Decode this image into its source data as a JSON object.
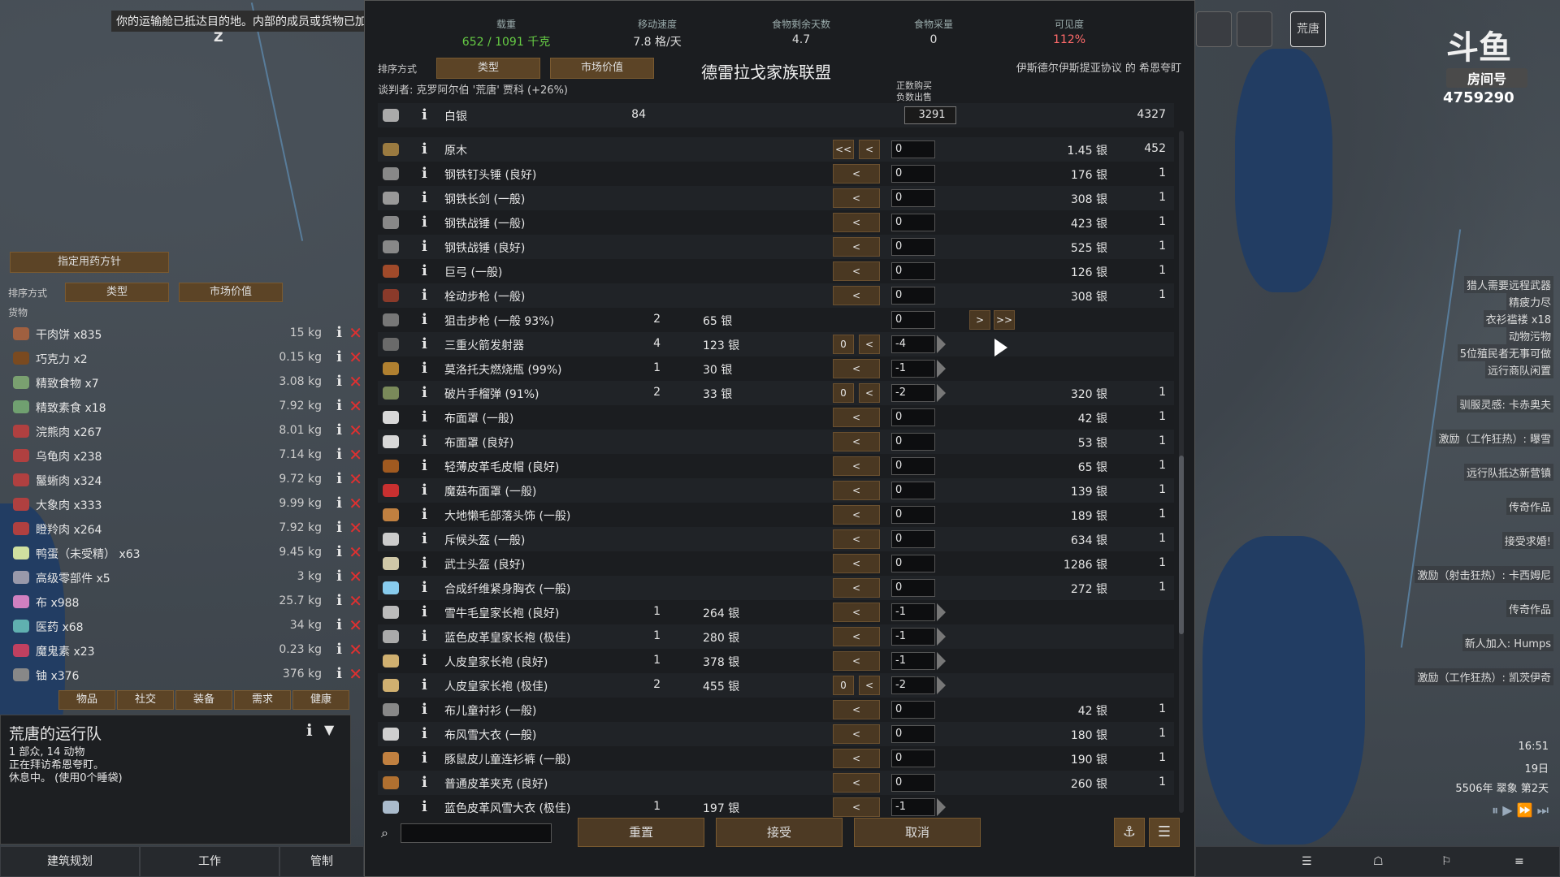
{
  "notification": "你的运输舱已抵达目的地。内部的成员或货物已加入荒唐的运行队。",
  "corner_letter": "Z",
  "stats": [
    {
      "label": "载重",
      "value": "652 / 1091 千克",
      "color": "#66cc44"
    },
    {
      "label": "移动速度",
      "value": "7.8 格/天",
      "color": "#dddddd"
    },
    {
      "label": "食物剩余天数",
      "value": "4.7",
      "color": "#dddddd"
    },
    {
      "label": "食物采量",
      "value": "0",
      "color": "#dddddd"
    },
    {
      "label": "可见度",
      "value": "112%",
      "color": "#ff6a6a"
    }
  ],
  "trade": {
    "sort_label": "排序方式",
    "sort_type": "类型",
    "sort_market": "市场价值",
    "faction": "德雷拉戈家族联盟",
    "settlement": "伊斯德尔伊斯提亚协议 的 希恩夸盯",
    "negotiator": "谈判者: 克罗阿尔伯 '荒唐' 贾科 (+26%)",
    "col_hint_1": "正数购买",
    "col_hint_2": "负数出售",
    "silver": {
      "name": "白银",
      "colony": "84",
      "amount": "3291",
      "trader": "4327"
    },
    "rows": [
      {
        "name": "原木",
        "cq": "",
        "cp": "",
        "left": "<<  <",
        "val": "0",
        "arrow": false,
        "tp": "1.45 银",
        "tq": "452",
        "icon": "#9a7a40"
      },
      {
        "name": "钢铁钉头锤 (良好)",
        "cq": "",
        "cp": "",
        "left": "<",
        "val": "0",
        "arrow": false,
        "tp": "176 银",
        "tq": "1",
        "icon": "#888888"
      },
      {
        "name": "钢铁长剑 (一般)",
        "cq": "",
        "cp": "",
        "left": "<",
        "val": "0",
        "arrow": false,
        "tp": "308 银",
        "tq": "1",
        "icon": "#999999"
      },
      {
        "name": "钢铁战锤 (一般)",
        "cq": "",
        "cp": "",
        "left": "<",
        "val": "0",
        "arrow": false,
        "tp": "423 银",
        "tq": "1",
        "icon": "#888888"
      },
      {
        "name": "钢铁战锤 (良好)",
        "cq": "",
        "cp": "",
        "left": "<",
        "val": "0",
        "arrow": false,
        "tp": "525 银",
        "tq": "1",
        "icon": "#888888"
      },
      {
        "name": "巨弓 (一般)",
        "cq": "",
        "cp": "",
        "left": "<",
        "val": "0",
        "arrow": false,
        "tp": "126 银",
        "tq": "1",
        "icon": "#a04a2a"
      },
      {
        "name": "栓动步枪 (一般)",
        "cq": "",
        "cp": "",
        "left": "<",
        "val": "0",
        "arrow": false,
        "tp": "308 银",
        "tq": "1",
        "icon": "#8a3a2a"
      },
      {
        "name": "狙击步枪 (一般 93%)",
        "cq": "2",
        "cp": "65 银",
        "left": "",
        "val": "0",
        "arrow": false,
        "tp": "",
        "tq": "",
        "icon": "#777777",
        "right": "> >>"
      },
      {
        "name": "三重火箭发射器",
        "cq": "4",
        "cp": "123 银",
        "left": "0 <",
        "val": "-4",
        "arrow": true,
        "tp": "",
        "tq": "",
        "icon": "#6a6a6a"
      },
      {
        "name": "莫洛托夫燃烧瓶 (99%)",
        "cq": "1",
        "cp": "30 银",
        "left": "<",
        "val": "-1",
        "arrow": true,
        "tp": "",
        "tq": "",
        "icon": "#b08030"
      },
      {
        "name": "破片手榴弹 (91%)",
        "cq": "2",
        "cp": "33 银",
        "left": "0 <",
        "val": "-2",
        "arrow": true,
        "tp": "320 银",
        "tq": "1",
        "icon": "#7a8a5a"
      },
      {
        "name": "布面罩 (一般)",
        "cq": "",
        "cp": "",
        "left": "<",
        "val": "0",
        "arrow": false,
        "tp": "42 银",
        "tq": "1",
        "icon": "#d8d8d8"
      },
      {
        "name": "布面罩 (良好)",
        "cq": "",
        "cp": "",
        "left": "<",
        "val": "0",
        "arrow": false,
        "tp": "53 银",
        "tq": "1",
        "icon": "#d8d8d8"
      },
      {
        "name": "轻薄皮革毛皮帽 (良好)",
        "cq": "",
        "cp": "",
        "left": "<",
        "val": "0",
        "arrow": false,
        "tp": "65 银",
        "tq": "1",
        "icon": "#a05a20"
      },
      {
        "name": "魔菇布面罩 (一般)",
        "cq": "",
        "cp": "",
        "left": "<",
        "val": "0",
        "arrow": false,
        "tp": "139 银",
        "tq": "1",
        "icon": "#c83030"
      },
      {
        "name": "大地懒毛部落头饰 (一般)",
        "cq": "",
        "cp": "",
        "left": "<",
        "val": "0",
        "arrow": false,
        "tp": "189 银",
        "tq": "1",
        "icon": "#c08040"
      },
      {
        "name": "斥候头盔 (一般)",
        "cq": "",
        "cp": "",
        "left": "<",
        "val": "0",
        "arrow": false,
        "tp": "634 银",
        "tq": "1",
        "icon": "#cccccc"
      },
      {
        "name": "武士头盔 (良好)",
        "cq": "",
        "cp": "",
        "left": "<",
        "val": "0",
        "arrow": false,
        "tp": "1286 银",
        "tq": "1",
        "icon": "#d0c8a8"
      },
      {
        "name": "合成纤维紧身胸衣 (一般)",
        "cq": "",
        "cp": "",
        "left": "<",
        "val": "0",
        "arrow": false,
        "tp": "272 银",
        "tq": "1",
        "icon": "#88ccee"
      },
      {
        "name": "雪牛毛皇家长袍 (良好)",
        "cq": "1",
        "cp": "264 银",
        "left": "<",
        "val": "-1",
        "arrow": true,
        "tp": "",
        "tq": "",
        "icon": "#bbbbbb"
      },
      {
        "name": "蓝色皮革皇家长袍 (极佳)",
        "cq": "1",
        "cp": "280 银",
        "left": "<",
        "val": "-1",
        "arrow": true,
        "tp": "",
        "tq": "",
        "icon": "#aaaaaa"
      },
      {
        "name": "人皮皇家长袍 (良好)",
        "cq": "1",
        "cp": "378 银",
        "left": "<",
        "val": "-1",
        "arrow": true,
        "tp": "",
        "tq": "",
        "icon": "#d0b070"
      },
      {
        "name": "人皮皇家长袍 (极佳)",
        "cq": "2",
        "cp": "455 银",
        "left": "0 <",
        "val": "-2",
        "arrow": true,
        "tp": "",
        "tq": "",
        "icon": "#d0b070"
      },
      {
        "name": "布儿童衬衫 (一般)",
        "cq": "",
        "cp": "",
        "left": "<",
        "val": "0",
        "arrow": false,
        "tp": "42 银",
        "tq": "1",
        "icon": "#888888"
      },
      {
        "name": "布风雪大衣 (一般)",
        "cq": "",
        "cp": "",
        "left": "<",
        "val": "0",
        "arrow": false,
        "tp": "180 银",
        "tq": "1",
        "icon": "#cfcfcf"
      },
      {
        "name": "豚鼠皮儿童连衫裤 (一般)",
        "cq": "",
        "cp": "",
        "left": "<",
        "val": "0",
        "arrow": false,
        "tp": "190 银",
        "tq": "1",
        "icon": "#c08040"
      },
      {
        "name": "普通皮革夹克 (良好)",
        "cq": "",
        "cp": "",
        "left": "<",
        "val": "0",
        "arrow": false,
        "tp": "260 银",
        "tq": "1",
        "icon": "#b07030"
      },
      {
        "name": "蓝色皮革风雪大衣 (极佳)",
        "cq": "1",
        "cp": "197 银",
        "left": "<",
        "val": "-1",
        "arrow": true,
        "tp": "",
        "tq": "",
        "icon": "#aabbcc"
      }
    ],
    "reset": "重置",
    "accept": "接受",
    "cancel": "取消"
  },
  "left": {
    "policy_button": "指定用药方针",
    "sort_label": "排序方式",
    "sort_type": "类型",
    "sort_market": "市场价值",
    "section": "货物",
    "items": [
      {
        "name": "干肉饼 x835",
        "wt": "15 kg",
        "icon": "#a06040"
      },
      {
        "name": "巧克力 x2",
        "wt": "0.15 kg",
        "icon": "#7a4a20"
      },
      {
        "name": "精致食物 x7",
        "wt": "3.08 kg",
        "icon": "#7aa070"
      },
      {
        "name": "精致素食 x18",
        "wt": "7.92 kg",
        "icon": "#70a070"
      },
      {
        "name": "浣熊肉 x267",
        "wt": "8.01 kg",
        "icon": "#b04040"
      },
      {
        "name": "乌龟肉 x238",
        "wt": "7.14 kg",
        "icon": "#b04040"
      },
      {
        "name": "鬣蜥肉 x324",
        "wt": "9.72 kg",
        "icon": "#b04040"
      },
      {
        "name": "大象肉 x333",
        "wt": "9.99 kg",
        "icon": "#b04040"
      },
      {
        "name": "瞪羚肉 x264",
        "wt": "7.92 kg",
        "icon": "#b04040"
      },
      {
        "name": "鸭蛋（未受精） x63",
        "wt": "9.45 kg",
        "icon": "#cfe0a0"
      },
      {
        "name": "高级零部件 x5",
        "wt": "3 kg",
        "icon": "#9999aa"
      },
      {
        "name": "布 x988",
        "wt": "25.7 kg",
        "icon": "#d080c0"
      },
      {
        "name": "医药 x68",
        "wt": "34 kg",
        "icon": "#60b0b0"
      },
      {
        "name": "魔鬼素 x23",
        "wt": "0.23 kg",
        "icon": "#c04060"
      },
      {
        "name": "铀 x376",
        "wt": "376 kg",
        "icon": "#888888"
      }
    ],
    "tabs": [
      "物品",
      "社交",
      "装备",
      "需求",
      "健康"
    ]
  },
  "caravan": {
    "title": "荒唐的运行队",
    "line1": "1 部众, 14 动物",
    "line2": "正在拜访希恩夸盯。",
    "line3": "休息中。 (使用0个睡袋)"
  },
  "bottom_bar": [
    "建筑规划",
    "工作",
    "管制"
  ],
  "room": {
    "logo": "斗鱼",
    "label": "房间号",
    "number": "4759290"
  },
  "alerts": [
    "猎人需要远程武器",
    "精疲力尽",
    "衣衫褴褛 x18",
    "动物污物",
    "5位殖民者无事可做",
    "远行商队闲置",
    "驯服灵感: 卡赤奥夫",
    "激励（工作狂热）: 曝雪",
    "远行队抵达新营镇",
    "传奇作品",
    "接受求婚!",
    "激励（射击狂热）: 卡西姆尼",
    "传奇作品",
    "新人加入: Humps",
    "激励（工作狂热）: 凯茨伊奇"
  ],
  "clock": {
    "time": "16:51",
    "day": "19日",
    "date": "5506年 翠象 第2天"
  },
  "colony_label": "荒唐"
}
